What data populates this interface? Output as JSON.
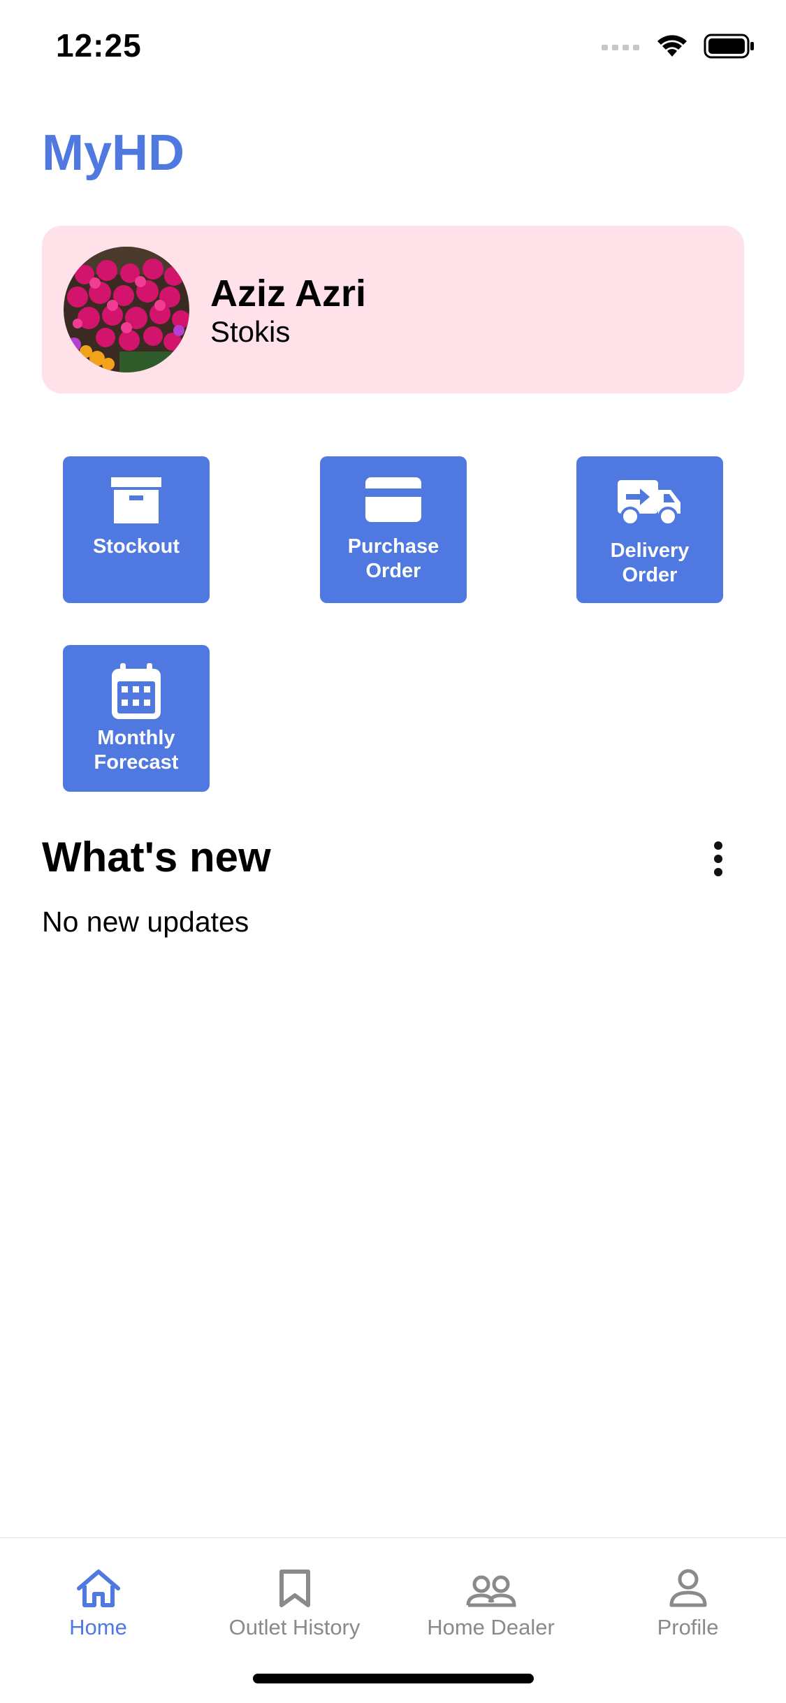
{
  "status_bar": {
    "time": "12:25"
  },
  "app": {
    "title": "MyHD",
    "accent_color": "#4f79e0",
    "card_color": "#fee1e9"
  },
  "profile": {
    "name": "Aziz Azri",
    "role": "Stokis",
    "avatar": "flower-photo"
  },
  "actions": [
    {
      "label": "Stockout",
      "icon": "archive-box-icon"
    },
    {
      "label": "Purchase\nOrder",
      "icon": "credit-card-icon"
    },
    {
      "label": "Delivery\nOrder",
      "icon": "delivery-truck-icon"
    },
    {
      "label": "Monthly\nForecast",
      "icon": "calendar-icon"
    }
  ],
  "whats_new": {
    "title": "What's new",
    "empty_text": "No new updates"
  },
  "tabs": [
    {
      "label": "Home",
      "icon": "home-icon",
      "active": true
    },
    {
      "label": "Outlet History",
      "icon": "bookmark-icon",
      "active": false
    },
    {
      "label": "Home Dealer",
      "icon": "people-icon",
      "active": false
    },
    {
      "label": "Profile",
      "icon": "person-icon",
      "active": false
    }
  ]
}
